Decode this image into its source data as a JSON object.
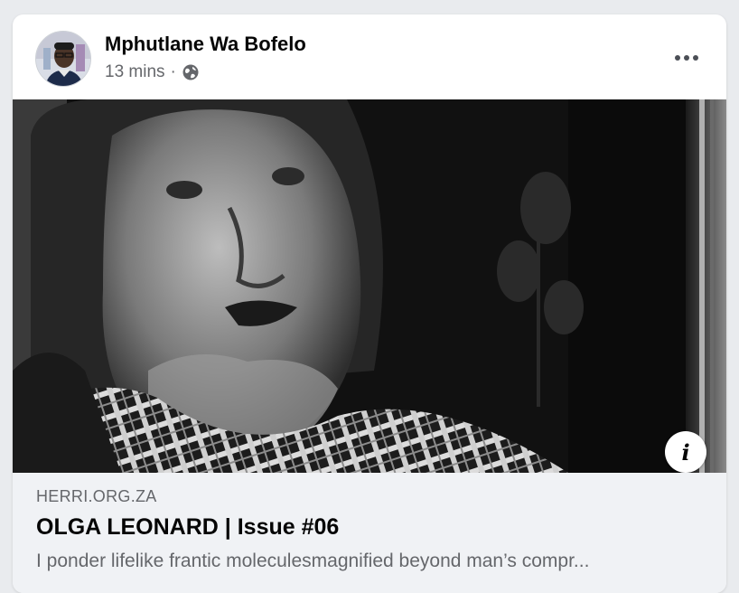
{
  "post": {
    "author": "Mphutlane Wa Bofelo",
    "time": "13 mins",
    "separator": "·",
    "privacy_icon": "globe-icon",
    "more_icon": "more-options-icon"
  },
  "photo": {
    "info_icon_glyph": "i"
  },
  "link": {
    "domain": "HERRI.ORG.ZA",
    "title": "OLGA LEONARD | Issue #06",
    "description": "I ponder lifelike frantic moleculesmagnified beyond man’s compr..."
  },
  "colors": {
    "name_text": "#050505",
    "secondary_text": "#65676b",
    "link_preview_bg": "#f0f2f5",
    "page_bg": "#e9ebee"
  }
}
